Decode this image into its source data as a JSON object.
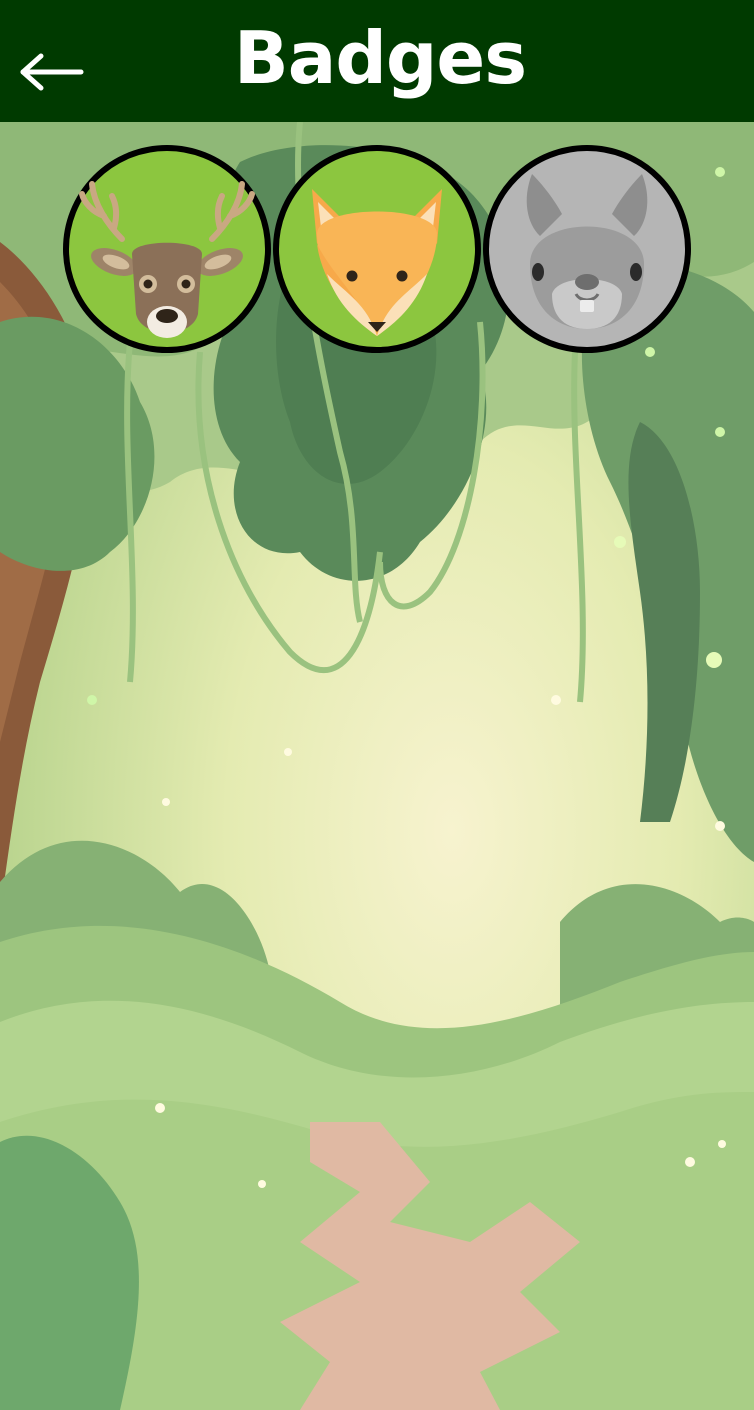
{
  "header": {
    "title": "Badges",
    "back_icon": "arrow-left-icon"
  },
  "badges": [
    {
      "animal": "deer",
      "icon": "deer-icon",
      "unlocked": true,
      "bg_color": "#8cc63f"
    },
    {
      "animal": "fox",
      "icon": "fox-icon",
      "unlocked": true,
      "bg_color": "#8cc63f"
    },
    {
      "animal": "squirrel",
      "icon": "squirrel-icon",
      "unlocked": false,
      "bg_color": "#b5b5b5"
    }
  ],
  "colors": {
    "header_bg": "#003a00",
    "header_text": "#ffffff",
    "badge_border": "#000000"
  }
}
